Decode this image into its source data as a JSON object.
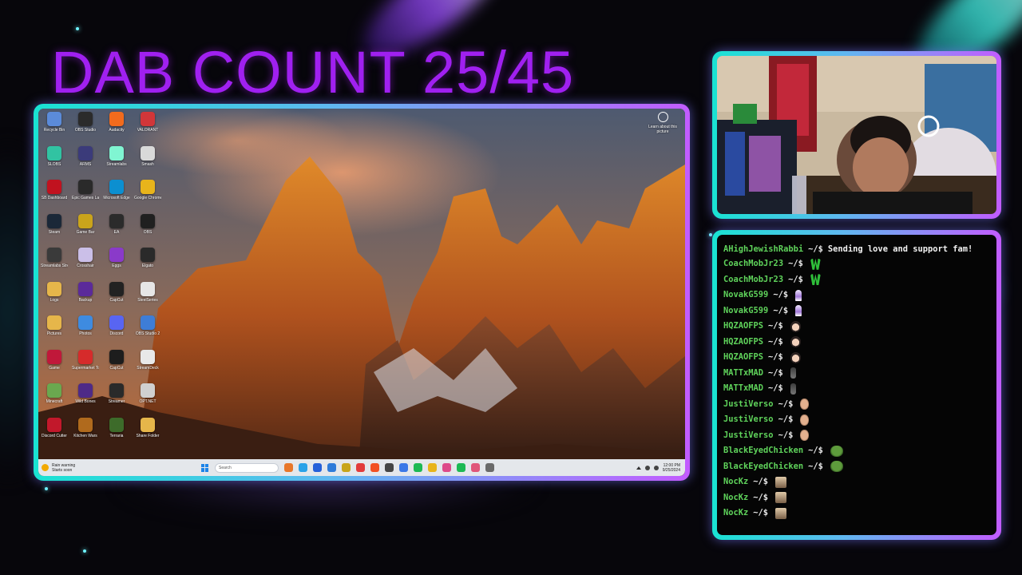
{
  "overlay": {
    "title": "DAB COUNT 25/45"
  },
  "desktop": {
    "icons": [
      {
        "label": "Recycle Bin",
        "icon": "recycle-bin-icon",
        "color": "#5b8bd9"
      },
      {
        "label": "OBS Studio",
        "icon": "obs-icon",
        "color": "#2b2b2b"
      },
      {
        "label": "Audacity",
        "icon": "audacity-icon",
        "color": "#f26b1d"
      },
      {
        "label": "VALORANT",
        "icon": "valorant-icon",
        "color": "#d13639"
      },
      {
        "label": "SLOBS",
        "icon": "slobs-icon",
        "color": "#31c3a2"
      },
      {
        "label": "ARMS",
        "icon": "game-icon",
        "color": "#3b3b7a"
      },
      {
        "label": "Streamlabs",
        "icon": "streamlabs-icon",
        "color": "#80f5d2"
      },
      {
        "label": "Smash",
        "icon": "smash-icon",
        "color": "#d9d9d9"
      },
      {
        "label": "SB Dashboard",
        "icon": "app-icon",
        "color": "#c1121f"
      },
      {
        "label": "Epic Games Launcher",
        "icon": "epic-icon",
        "color": "#2a2a2a"
      },
      {
        "label": "Microsoft Edge",
        "icon": "edge-icon",
        "color": "#0c8fd0"
      },
      {
        "label": "Google Chrome",
        "icon": "chrome-icon",
        "color": "#e8b41b"
      },
      {
        "label": "Steam",
        "icon": "steam-icon",
        "color": "#1b2838"
      },
      {
        "label": "Game Bar",
        "icon": "game-icon",
        "color": "#caa41b"
      },
      {
        "label": "EA",
        "icon": "ea-icon",
        "color": "#2b2b2b"
      },
      {
        "label": "OBS",
        "icon": "obs-icon",
        "color": "#202020"
      },
      {
        "label": "Streamlabs Stream",
        "icon": "streamlabs-icon",
        "color": "#3a3a3a"
      },
      {
        "label": "Crosshair",
        "icon": "app-icon",
        "color": "#cbbfe8"
      },
      {
        "label": "Eggs",
        "icon": "app-icon",
        "color": "#8a3ac9"
      },
      {
        "label": "Elgato",
        "icon": "elgato-icon",
        "color": "#2a2a2a"
      },
      {
        "label": "Logs",
        "icon": "folder-icon",
        "color": "#e6b64a"
      },
      {
        "label": "Backup",
        "icon": "app-icon",
        "color": "#5b2a9a"
      },
      {
        "label": "CapCut",
        "icon": "capcut-icon",
        "color": "#222222"
      },
      {
        "label": "SteelSeries",
        "icon": "app-icon",
        "color": "#e6e6e6"
      },
      {
        "label": "Pictures",
        "icon": "folder-icon",
        "color": "#e6b64a"
      },
      {
        "label": "Photos",
        "icon": "photos-icon",
        "color": "#3e8be0"
      },
      {
        "label": "Discord",
        "icon": "discord-icon",
        "color": "#5865f2"
      },
      {
        "label": "OBS Studio 2",
        "icon": "obs-icon",
        "color": "#3e7dd6"
      },
      {
        "label": "Game",
        "icon": "game-icon",
        "color": "#c0183a"
      },
      {
        "label": "Supermarket Together",
        "icon": "game-icon",
        "color": "#d62b2b"
      },
      {
        "label": "CapCut",
        "icon": "capcut-icon",
        "color": "#1d1d1d"
      },
      {
        "label": "StreamDeck",
        "icon": "app-icon",
        "color": "#e8e8e8"
      },
      {
        "label": "Minecraft",
        "icon": "minecraft-icon",
        "color": "#6aa84f"
      },
      {
        "label": "Wild Bones",
        "icon": "game-icon",
        "color": "#4e2a87"
      },
      {
        "label": "Streamer",
        "icon": "app-icon",
        "color": "#2a2a2a"
      },
      {
        "label": "OPT.NET",
        "icon": "app-icon",
        "color": "#d0d0d0"
      },
      {
        "label": "Discord Cutter",
        "icon": "app-icon",
        "color": "#c2182b"
      },
      {
        "label": "Kitchen Wars",
        "icon": "game-icon",
        "color": "#b06a1d"
      },
      {
        "label": "Terraria",
        "icon": "terraria-icon",
        "color": "#3d6b2a"
      },
      {
        "label": "Share Folder",
        "icon": "folder-icon",
        "color": "#e6b64a"
      }
    ],
    "learn_more": "Learn about this picture",
    "taskbar": {
      "weather_line1": "Rain warning",
      "weather_line2": "Starts soon",
      "search_placeholder": "Search",
      "apps": [
        "#e8772a",
        "#2aa2e8",
        "#2560d9",
        "#2e7bd9",
        "#c8a51b",
        "#e23b3b",
        "#f25022",
        "#454545",
        "#3b78e7",
        "#1db954",
        "#e8b41b",
        "#dd4a8a",
        "#1db954",
        "#e0567a",
        "#6a6a6a"
      ],
      "clock_time": "12:00 PM",
      "clock_date": "9/25/2024"
    }
  },
  "chat": {
    "messages": [
      {
        "user": "AHighJewishRabbi",
        "prompt": "~/$",
        "text": "Sending love and support fam!",
        "emote": ""
      },
      {
        "user": "CoachMobJr23",
        "prompt": "~/$",
        "text": "",
        "emote": "w-emote"
      },
      {
        "user": "CoachMobJr23",
        "prompt": "~/$",
        "text": "",
        "emote": "w-emote"
      },
      {
        "user": "NovakG599",
        "prompt": "~/$",
        "text": "",
        "emote": "wizard-emote"
      },
      {
        "user": "NovakG599",
        "prompt": "~/$",
        "text": "",
        "emote": "wizard-emote"
      },
      {
        "user": "HQZAOFPS",
        "prompt": "~/$",
        "text": "",
        "emote": "anime-emote"
      },
      {
        "user": "HQZAOFPS",
        "prompt": "~/$",
        "text": "",
        "emote": "anime-emote"
      },
      {
        "user": "HQZAOFPS",
        "prompt": "~/$",
        "text": "",
        "emote": "anime-emote"
      },
      {
        "user": "MATTxMAD",
        "prompt": "~/$",
        "text": "",
        "emote": "figure-emote"
      },
      {
        "user": "MATTxMAD",
        "prompt": "~/$",
        "text": "",
        "emote": "figure-emote"
      },
      {
        "user": "JustiVerso",
        "prompt": "~/$",
        "text": "",
        "emote": "face-emote"
      },
      {
        "user": "JustiVerso",
        "prompt": "~/$",
        "text": "",
        "emote": "face-emote"
      },
      {
        "user": "JustiVerso",
        "prompt": "~/$",
        "text": "",
        "emote": "face-emote"
      },
      {
        "user": "BlackEyedChicken",
        "prompt": "~/$",
        "text": "",
        "emote": "pepe-emote"
      },
      {
        "user": "BlackEyedChicken",
        "prompt": "~/$",
        "text": "",
        "emote": "pepe-emote"
      },
      {
        "user": "NocKz",
        "prompt": "~/$",
        "text": "",
        "emote": "dog-emote"
      },
      {
        "user": "NocKz",
        "prompt": "~/$",
        "text": "",
        "emote": "dog-emote"
      },
      {
        "user": "NocKz",
        "prompt": "~/$",
        "text": "",
        "emote": "dog-emote"
      }
    ]
  },
  "colors": {
    "title": "#a020f0",
    "username": "#5fd35b",
    "frame_start": "#19e3d3",
    "frame_end": "#c25cff"
  }
}
